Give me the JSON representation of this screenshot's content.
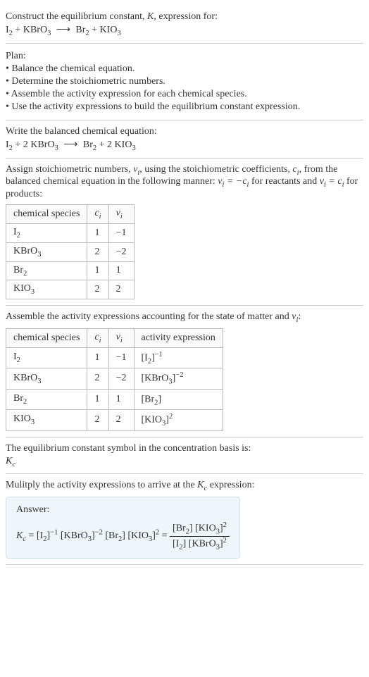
{
  "intro": {
    "line1_a": "Construct the equilibrium constant, ",
    "line1_b": ", expression for:"
  },
  "eq1": {
    "I2": "I",
    "I2sub": "2",
    "plus1": " + ",
    "KBrO3": "KBrO",
    "KBrO3sub": "3",
    "arrow": "⟶",
    "Br2": "Br",
    "Br2sub": "2",
    "plus2": " + ",
    "KIO3": "KIO",
    "KIO3sub": "3"
  },
  "plan": {
    "heading": "Plan:",
    "b1": "• Balance the chemical equation.",
    "b2": "• Determine the stoichiometric numbers.",
    "b3": "• Assemble the activity expression for each chemical species.",
    "b4": "• Use the activity expressions to build the equilibrium constant expression."
  },
  "balanced": {
    "heading": "Write the balanced chemical equation:",
    "coef_KBrO3": "2 ",
    "coef_KIO3": "2 "
  },
  "stoich": {
    "text_a": "Assign stoichiometric numbers, ",
    "text_b": ", using the stoichiometric coefficients, ",
    "text_c": ", from the balanced chemical equation in the following manner: ",
    "text_d": " for reactants and ",
    "text_e": " for products:",
    "nu": "ν",
    "nui": "i",
    "c": "c",
    "ci": "i",
    "eq_react_l": "ν",
    "eq_react_r": " = −c",
    "eq_prod_l": "ν",
    "eq_prod_r": " = c",
    "headers": {
      "h1": "chemical species",
      "h2": "c",
      "h2sub": "i",
      "h3": "ν",
      "h3sub": "i"
    },
    "rows": [
      {
        "sp": "I",
        "spsub": "2",
        "c": "1",
        "nu": "−1"
      },
      {
        "sp": "KBrO",
        "spsub": "3",
        "c": "2",
        "nu": "−2"
      },
      {
        "sp": "Br",
        "spsub": "2",
        "c": "1",
        "nu": "1"
      },
      {
        "sp": "KIO",
        "spsub": "3",
        "c": "2",
        "nu": "2"
      }
    ]
  },
  "activity": {
    "text_a": "Assemble the activity expressions accounting for the state of matter and ",
    "text_b": ":",
    "headers": {
      "h1": "chemical species",
      "h2": "c",
      "h2sub": "i",
      "h3": "ν",
      "h3sub": "i",
      "h4": "activity expression"
    },
    "rows": [
      {
        "sp": "I",
        "spsub": "2",
        "c": "1",
        "nu": "−1",
        "act_base": "[I",
        "act_sub": "2",
        "act_close": "]",
        "act_sup": "−1"
      },
      {
        "sp": "KBrO",
        "spsub": "3",
        "c": "2",
        "nu": "−2",
        "act_base": "[KBrO",
        "act_sub": "3",
        "act_close": "]",
        "act_sup": "−2"
      },
      {
        "sp": "Br",
        "spsub": "2",
        "c": "1",
        "nu": "1",
        "act_base": "[Br",
        "act_sub": "2",
        "act_close": "]",
        "act_sup": ""
      },
      {
        "sp": "KIO",
        "spsub": "3",
        "c": "2",
        "nu": "2",
        "act_base": "[KIO",
        "act_sub": "3",
        "act_close": "]",
        "act_sup": "2"
      }
    ]
  },
  "symbol": {
    "text": "The equilibrium constant symbol in the concentration basis is:",
    "K": "K",
    "Ksub": "c"
  },
  "final": {
    "text_a": "Mulitply the activity expressions to arrive at the ",
    "text_b": " expression:",
    "answer_label": "Answer:",
    "eq": {
      "Kc_K": "K",
      "Kc_sub": "c",
      "equals": " = ",
      "t1": "[I",
      "t1sub": "2",
      "t1close": "]",
      "t1sup": "−1",
      "sp": " ",
      "t2": "[KBrO",
      "t2sub": "3",
      "t2close": "]",
      "t2sup": "−2",
      "t3": "[Br",
      "t3sub": "2",
      "t3close": "]",
      "t4": "[KIO",
      "t4sub": "3",
      "t4close": "]",
      "t4sup": "2",
      "equals2": " = ",
      "num1": "[Br",
      "num1sub": "2",
      "num1close": "] ",
      "num2": "[KIO",
      "num2sub": "3",
      "num2close": "]",
      "num2sup": "2",
      "den1": "[I",
      "den1sub": "2",
      "den1close": "] ",
      "den2": "[KBrO",
      "den2sub": "3",
      "den2close": "]",
      "den2sup": "2"
    }
  }
}
